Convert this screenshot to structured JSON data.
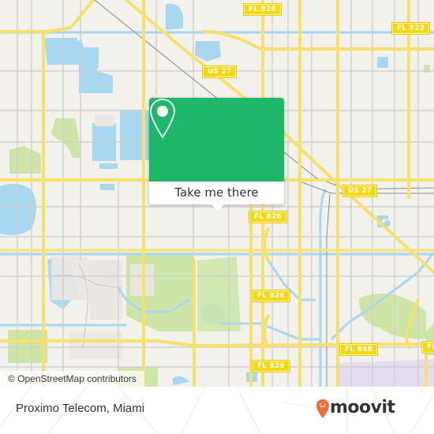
{
  "map": {
    "colors": {
      "background": "#f2f1ec",
      "water": "#a8d8ef",
      "park": "#cde6a8",
      "residential": "#ebe6e4",
      "road_major": "#f7e16b",
      "road_minor": "#cfcccb",
      "airport": "#e6dcef"
    },
    "road_labels": [
      {
        "text": "FL 826"
      },
      {
        "text": "FL 823"
      },
      {
        "text": "US 27"
      },
      {
        "text": "US 27"
      },
      {
        "text": "FL 826"
      },
      {
        "text": "FL 826"
      },
      {
        "text": "FL 948"
      },
      {
        "text": "FL 826"
      },
      {
        "text": "FL"
      }
    ],
    "attribution": "© OpenStreetMap contributors"
  },
  "popup": {
    "button_label": "Take me there",
    "icon": "map-pin-icon",
    "accent_color": "#1fb86a"
  },
  "footer": {
    "place_name": "Proximo Telecom, Miami",
    "brand": "moovit",
    "brand_color": "#f26b3a"
  }
}
